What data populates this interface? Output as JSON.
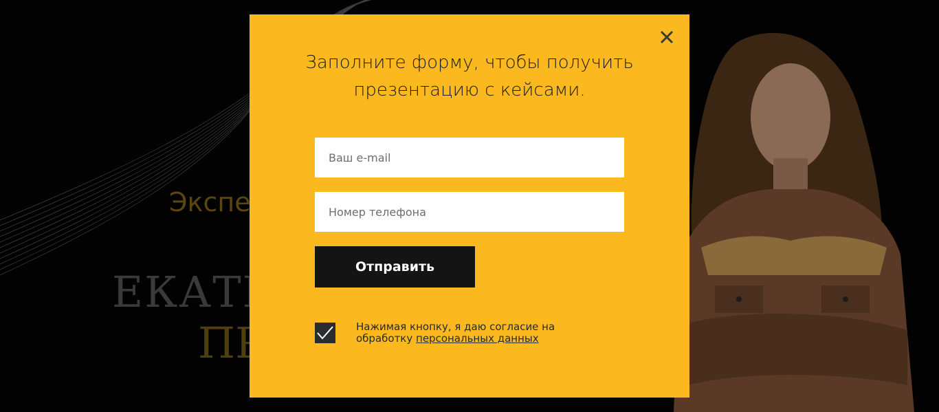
{
  "background": {
    "eyebrow": "Экспе",
    "name": "ЕКАТЕ",
    "role": "ПР"
  },
  "modal": {
    "title_line1": "Заполните форму, чтобы получить",
    "title_line2": "презентацию с кейсами.",
    "email_placeholder": "Ваш e-mail",
    "email_value": "",
    "phone_placeholder": "Номер телефона",
    "phone_value": "",
    "submit_label": "Отправить",
    "consent_checked": true,
    "consent_text": "Нажимая кнопку, я даю согласие на обработку ",
    "consent_link": "персональных данных",
    "close_icon": "close-icon",
    "check_icon": "checkmark-icon"
  },
  "colors": {
    "modal_bg": "#fbb91f",
    "button_bg": "#141414",
    "checkbox_bg": "#2b2c30",
    "overlay": "#020202"
  }
}
